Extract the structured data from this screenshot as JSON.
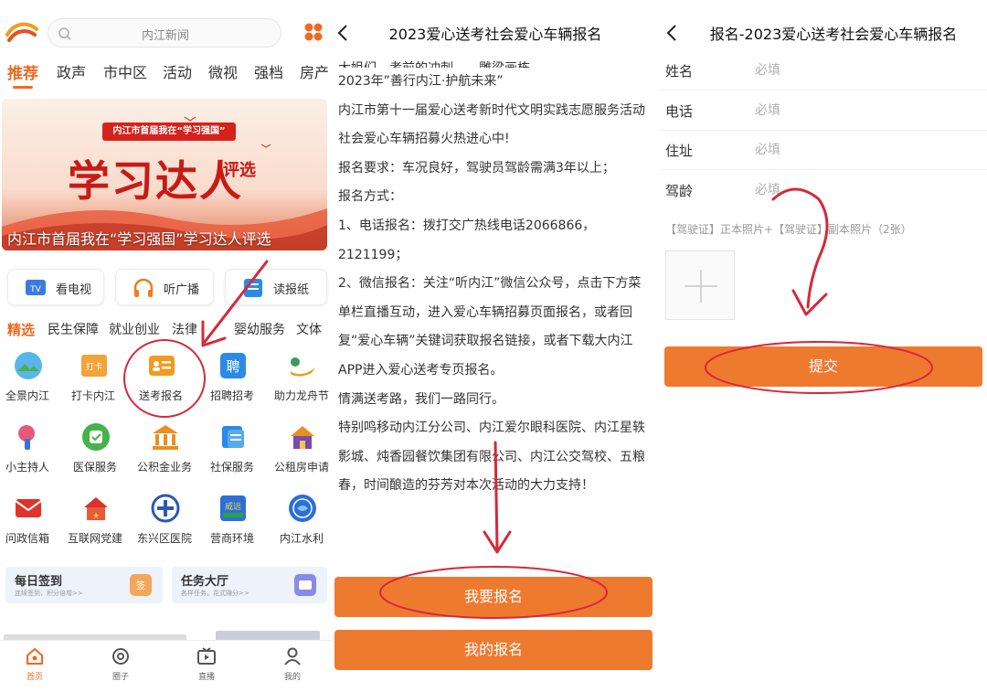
{
  "colors": {
    "accent": "#ee6a20",
    "button": "#ee7a30",
    "annotation": "#d6283a"
  },
  "left": {
    "search_placeholder": "内江新闻",
    "tabs": [
      "推荐",
      "政声",
      "市中区",
      "活动",
      "微视",
      "强档",
      "房产"
    ],
    "banner": {
      "subtitle": "内江市首届我在“学习强国”",
      "headline": "学习达人",
      "headline_suffix": "评选",
      "caption": "内江市首届我在“学习强国”学习达人评选"
    },
    "quick": [
      {
        "label": "看电视",
        "icon": "tv-icon"
      },
      {
        "label": "听广播",
        "icon": "headphones-icon"
      },
      {
        "label": "读报纸",
        "icon": "newspaper-icon"
      }
    ],
    "categories": [
      "精选",
      "民生保障",
      "就业创业",
      "法律",
      "婴幼服务",
      "文体"
    ],
    "services": [
      {
        "label": "全景内江",
        "icon": "panorama-icon"
      },
      {
        "label": "打卡内江",
        "icon": "checkin-icon"
      },
      {
        "label": "送考报名",
        "icon": "id-card-icon"
      },
      {
        "label": "招聘招考",
        "icon": "recruit-icon"
      },
      {
        "label": "助力龙舟节",
        "icon": "dragon-boat-icon"
      },
      {
        "label": "小主持人",
        "icon": "microphone-icon"
      },
      {
        "label": "医保服务",
        "icon": "medical-insurance-icon"
      },
      {
        "label": "公积金业务",
        "icon": "bank-icon"
      },
      {
        "label": "社保服务",
        "icon": "social-security-icon"
      },
      {
        "label": "公租房申请",
        "icon": "house-icon"
      },
      {
        "label": "问政信箱",
        "icon": "mailbox-icon"
      },
      {
        "label": "互联网党建",
        "icon": "party-building-icon"
      },
      {
        "label": "东兴区医院",
        "icon": "hospital-icon"
      },
      {
        "label": "营商环境",
        "icon": "business-icon"
      },
      {
        "label": "内江水利",
        "icon": "water-icon"
      }
    ],
    "cards": [
      {
        "title": "每日签到",
        "subtitle": "连续签到，积分倍增>>",
        "icon": "sign-in-icon"
      },
      {
        "title": "任务大厅",
        "subtitle": "各样任务，花式赚分>>",
        "icon": "task-icon"
      }
    ],
    "nav": [
      {
        "label": "首页",
        "icon": "home-icon"
      },
      {
        "label": "圈子",
        "icon": "circle-icon"
      },
      {
        "label": "直播",
        "icon": "live-icon"
      },
      {
        "label": "我的",
        "icon": "user-icon"
      }
    ]
  },
  "middle": {
    "title": "2023爱心送考社会爱心车辆报名",
    "paragraphs": [
      "2023年”善行内江·护航未来”",
      "内江市第十一届爱心送考新时代文明实践志愿服务活动",
      "社会爱心车辆招募火热进心中!",
      "报名要求：车况良好，驾驶员驾龄需满3年以上；",
      "报名方式：",
      "1、电话报名：拨打交广热线电话2066866，2121199；",
      "2、微信报名：关注“听内江”微信公众号，点击下方菜单栏直播互动，进入爱心车辆招募页面报名，或者回复“爱心车辆”关键词获取报名链接，或者下载大内江APP进入爱心送考专页报名。",
      "情满送考路，我们一路同行。",
      "特别鸣移动内江分公司、内江爱尔眼科医院、内江星轶影城、炖香园餐饮集团有限公司、内江公交驾校、五粮春，时间酿造的芬芳对本次活动的大力支持！"
    ],
    "btn_signup": "我要报名",
    "btn_mine": "我的报名"
  },
  "right": {
    "title": "报名-2023爱心送考社会爱心车辆报名",
    "fields": [
      {
        "label": "姓名",
        "placeholder": "必填"
      },
      {
        "label": "电话",
        "placeholder": "必填"
      },
      {
        "label": "住址",
        "placeholder": "必填"
      },
      {
        "label": "驾龄",
        "placeholder": "必填"
      }
    ],
    "upload_hint": "【驾驶证】正本照片+【驾驶证】副本照片（2张）",
    "submit": "提交"
  }
}
